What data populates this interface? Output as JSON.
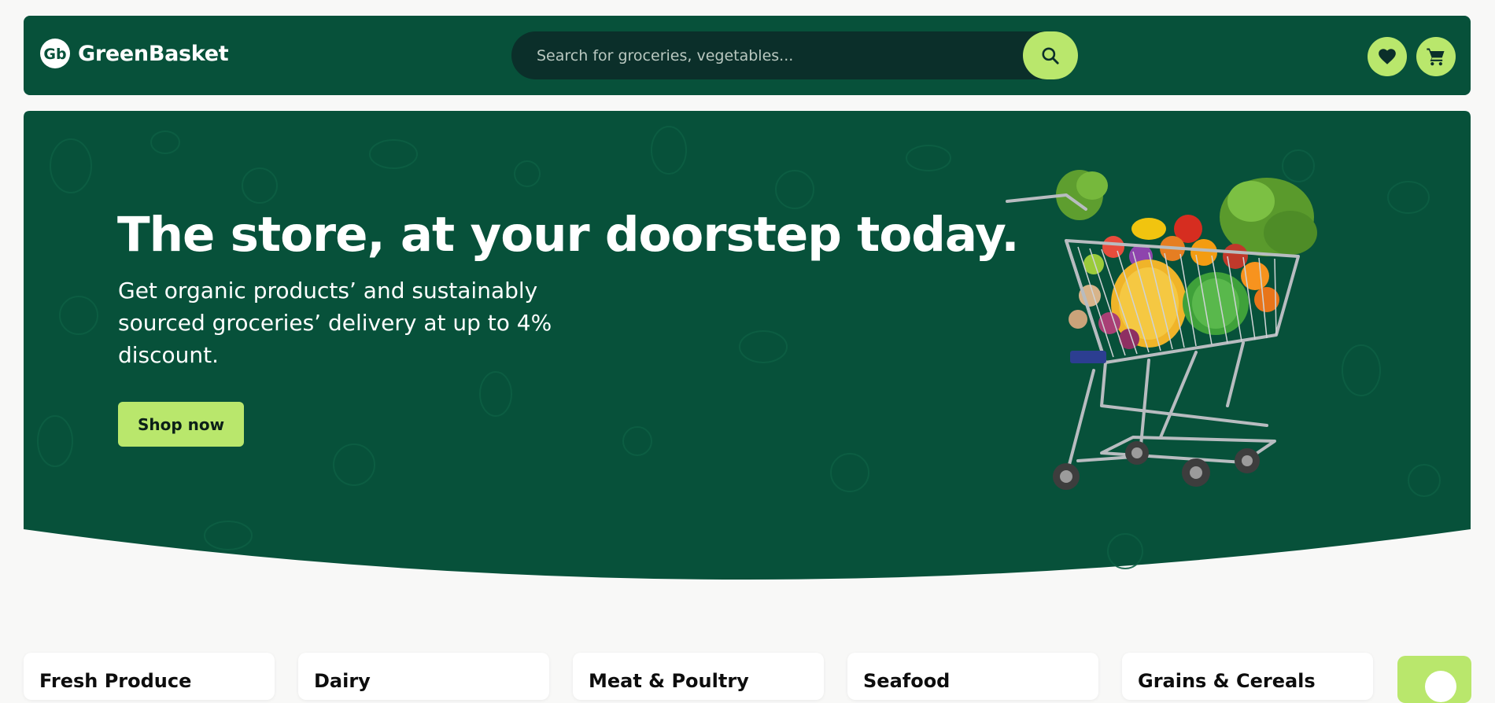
{
  "header": {
    "brand": "GreenBasket",
    "search_placeholder": "Search for groceries, vegetables...",
    "icons": {
      "search": "search-icon",
      "wishlist": "heart-icon",
      "cart": "cart-icon"
    }
  },
  "hero": {
    "title": "The store, at your doorstep today.",
    "subtitle": "Get organic products’ and sustainably sourced groceries’ delivery at up to 4% discount.",
    "cta_label": "Shop now"
  },
  "categories": [
    {
      "label": "Fresh Produce"
    },
    {
      "label": "Dairy"
    },
    {
      "label": "Meat & Poultry"
    },
    {
      "label": "Seafood"
    },
    {
      "label": "Grains & Cereals"
    }
  ],
  "colors": {
    "primary_green": "#07513a",
    "accent_lime": "#b9e76c",
    "search_bg": "#0b2f2a",
    "page_bg": "#f8f8f7"
  }
}
